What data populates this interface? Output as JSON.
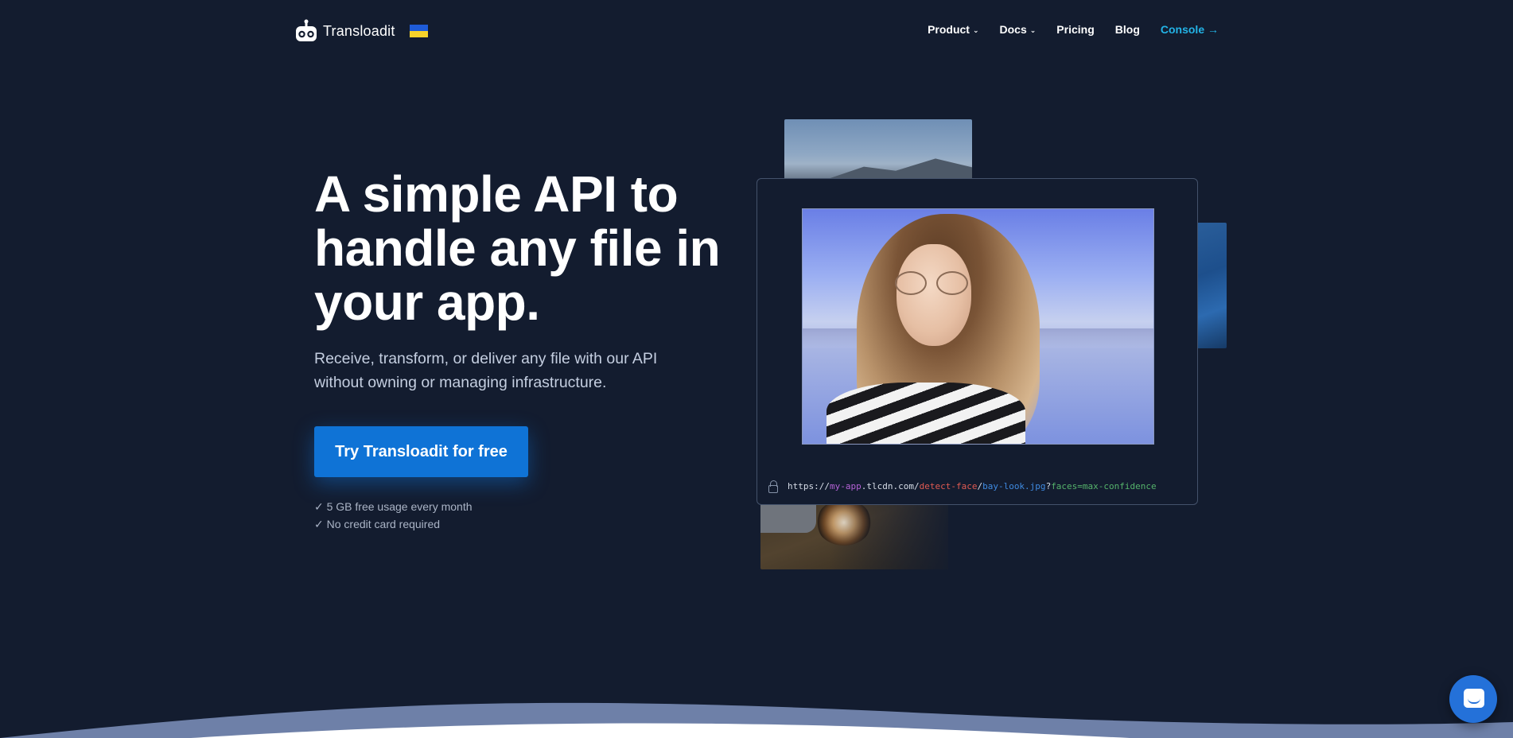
{
  "nav": {
    "brand": "Transloadit",
    "items": [
      {
        "label": "Product",
        "has_caret": true
      },
      {
        "label": "Docs",
        "has_caret": true
      },
      {
        "label": "Pricing",
        "has_caret": false
      },
      {
        "label": "Blog",
        "has_caret": false
      }
    ],
    "console_label": "Console →",
    "caret_glyph": "⌄"
  },
  "hero": {
    "headline": "A simple API to handle any file in your app.",
    "subtitle": "Receive, transform, or deliver any file with our API without owning or managing infrastructure.",
    "cta_label": "Try Transloadit for free",
    "perks": [
      "✓ 5 GB free usage every month",
      "✓ No credit card required"
    ]
  },
  "demo": {
    "url_parts": [
      {
        "text": "https://",
        "color": "#d7dde8"
      },
      {
        "text": "my-app",
        "color": "#b562d6"
      },
      {
        "text": ".tlcdn.com/",
        "color": "#d7dde8"
      },
      {
        "text": "detect-face",
        "color": "#e05a52"
      },
      {
        "text": "/",
        "color": "#d7dde8"
      },
      {
        "text": "bay-look.jpg",
        "color": "#3f8ae0"
      },
      {
        "text": "?",
        "color": "#d7dde8"
      },
      {
        "text": "faces=max-confidence",
        "color": "#55b36b"
      }
    ]
  },
  "colors": {
    "background": "#131c2f",
    "accent": "#0f73d6",
    "console_link": "#23b3e6",
    "flag_blue": "#1e5bd8",
    "flag_yellow": "#f6d22a"
  },
  "icons": {
    "logo": "robot-logo-icon",
    "lock": "lock-icon",
    "chat": "chat-icon"
  }
}
